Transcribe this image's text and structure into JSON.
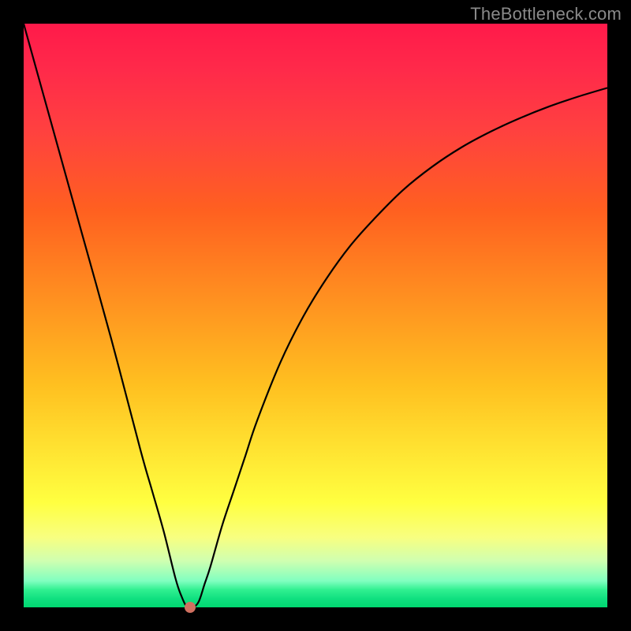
{
  "watermark": "TheBottleneck.com",
  "chart_data": {
    "type": "line",
    "title": "",
    "xlabel": "",
    "ylabel": "",
    "x": [
      0,
      5,
      10,
      15,
      20,
      22,
      24,
      26,
      27,
      28,
      29,
      30,
      31,
      32,
      34,
      36,
      38,
      40,
      44,
      48,
      52,
      56,
      60,
      65,
      70,
      75,
      80,
      85,
      90,
      95,
      100
    ],
    "y": [
      100,
      82,
      64,
      46,
      27,
      20,
      13,
      5,
      2,
      0,
      0,
      1,
      4,
      7,
      14,
      20,
      26,
      32,
      42,
      50,
      56.5,
      62,
      66.5,
      71.5,
      75.5,
      78.8,
      81.5,
      83.8,
      85.8,
      87.5,
      89
    ],
    "xlim": [
      0,
      100
    ],
    "ylim": [
      0,
      100
    ],
    "minimum_marker": {
      "x": 28.5,
      "y": 0
    }
  },
  "colors": {
    "curve": "#000000",
    "dot": "#d07060",
    "background_frame": "#000000"
  }
}
